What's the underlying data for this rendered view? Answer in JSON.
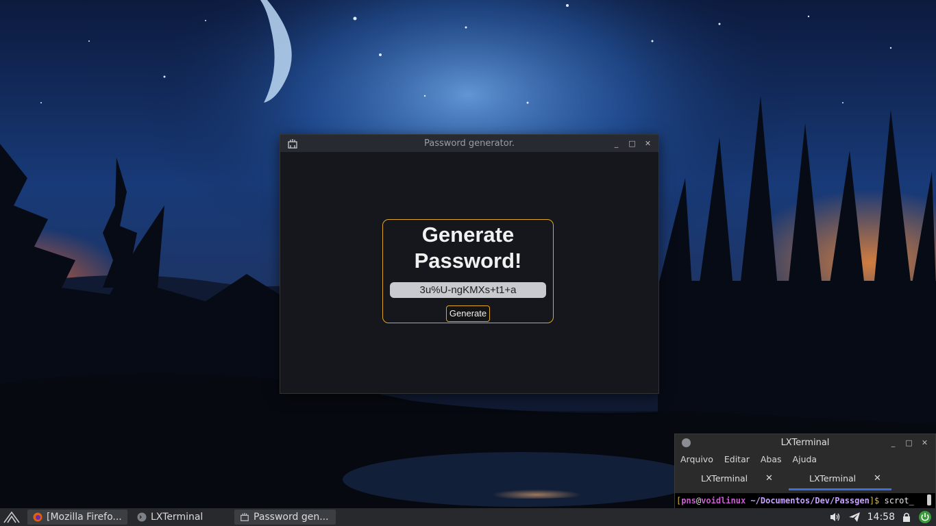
{
  "password_window": {
    "title": "Password generator.",
    "heading_line1": "Generate",
    "heading_line2": "Password!",
    "password_value": "3u%U-ngKMXs+t1+a",
    "generate_label": "Generate",
    "accent_color": "#e0a826"
  },
  "terminal_window": {
    "title": "LXTerminal",
    "menu": [
      "Arquivo",
      "Editar",
      "Abas",
      "Ajuda"
    ],
    "tabs": [
      {
        "label": "LXTerminal",
        "close": "✕"
      },
      {
        "label": "LXTerminal",
        "close": "✕"
      }
    ],
    "prompt": {
      "open": "[",
      "user": "pns",
      "at": "@",
      "host": "voidlinux",
      "path": "~/Documentos/Dev/Passgen",
      "close": "]$",
      "command": "scrot_"
    }
  },
  "taskbar": {
    "tasks": [
      {
        "label": "[Mozilla Firefo...",
        "icon": "firefox-icon"
      },
      {
        "label": "LXTerminal",
        "icon": "terminal-icon"
      },
      {
        "label": "Password gen...",
        "icon": "app-icon"
      }
    ],
    "clock": "14:58"
  },
  "window_controls": {
    "minimize": "_",
    "maximize": "□",
    "close": "✕"
  }
}
